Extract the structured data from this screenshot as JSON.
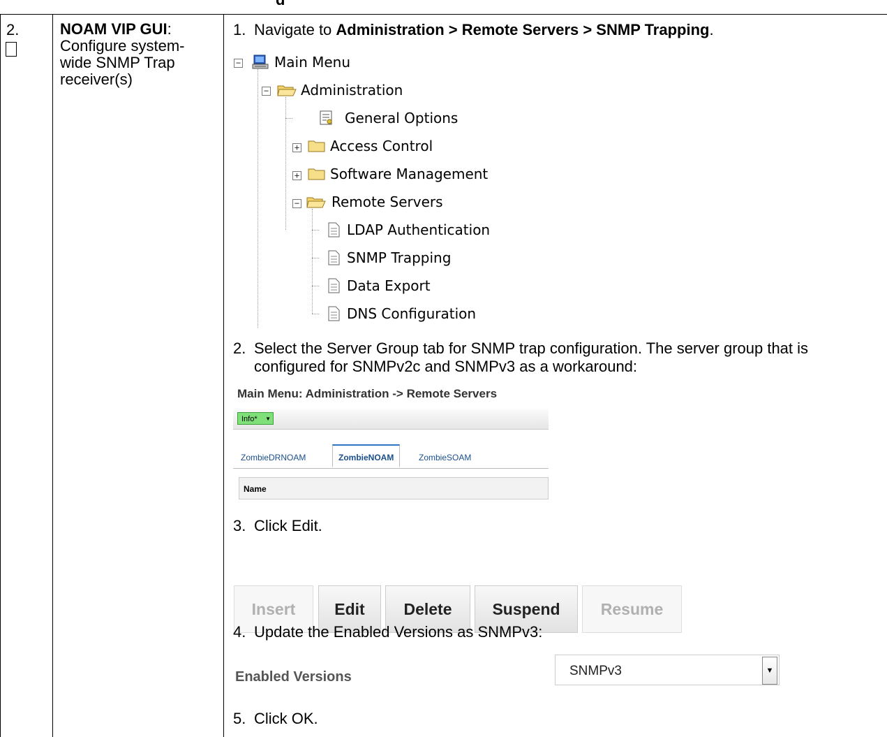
{
  "top_fragment": "g",
  "step": {
    "number": "2.",
    "title": "NOAM VIP GUI",
    "colon": ":",
    "description": "Configure system-wide SNMP Trap receiver(s)"
  },
  "instructions": {
    "s1_num": "1.",
    "s1_pre": "Navigate to ",
    "s1_bold": "Administration > Remote Servers > SNMP Trapping",
    "s1_post": ".",
    "s2_num": "2.",
    "s2_text": "Select the Server Group tab for SNMP trap configuration.  The server group that is configured for SNMPv2c and SNMPv3 as a workaround:",
    "s3_num": "3.",
    "s3_text": "Click Edit.",
    "s4_num": "4.",
    "s4_text": "Update the Enabled Versions as SNMPv3:",
    "s5_num": "5.",
    "s5_text": "Click OK."
  },
  "tree": {
    "main_menu": "Main Menu",
    "administration": "Administration",
    "general_options": "General Options",
    "access_control": "Access Control",
    "software_management": "Software Management",
    "remote_servers": "Remote Servers",
    "ldap_authentication": "LDAP Authentication",
    "snmp_trapping": "SNMP Trapping",
    "data_export": "Data Export",
    "dns_configuration": "DNS Configuration"
  },
  "screenshot": {
    "title": "Main Menu: Administration -> Remote Servers",
    "info_label": "Info*",
    "tabs": [
      "ZombieDRNOAM",
      "ZombieNOAM",
      "ZombieSOAM"
    ],
    "active_tab": "ZombieNOAM",
    "column_header": "Name"
  },
  "buttons": {
    "insert": "Insert",
    "edit": "Edit",
    "delete": "Delete",
    "suspend": "Suspend",
    "resume": "Resume"
  },
  "enabled_versions": {
    "label": "Enabled Versions",
    "value": "SNMPv3"
  }
}
